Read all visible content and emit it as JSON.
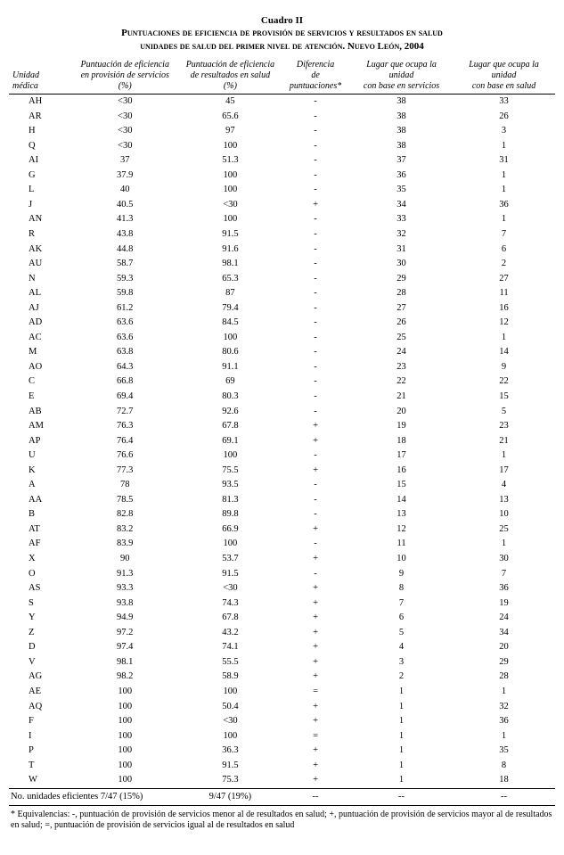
{
  "title": {
    "line1": "Cuadro II",
    "line2": "Puntuaciones de eficiencia de provisión de servicios y resultados en salud",
    "line3": "unidades de salud del primer nivel de atención. Nuevo León, 2004"
  },
  "headers": {
    "unidad": "Unidad médica",
    "h1a": "Puntuación de eficiencia",
    "h1b": "en provisión de servicios (%)",
    "h2a": "Puntuación de eficiencia",
    "h2b": "de resultados en salud (%)",
    "h3a": "Diferencia",
    "h3b": "de puntuaciones*",
    "h4a": "Lugar que ocupa la unidad",
    "h4b": "con base en servicios",
    "h5a": "Lugar que ocupa la unidad",
    "h5b": "con base en salud"
  },
  "chart_data": {
    "type": "table",
    "rows": [
      {
        "u": "AH",
        "c1": "<30",
        "c2": "45",
        "c3": "-",
        "c4": "38",
        "c5": "33"
      },
      {
        "u": "AR",
        "c1": "<30",
        "c2": "65.6",
        "c3": "-",
        "c4": "38",
        "c5": "26"
      },
      {
        "u": "H",
        "c1": "<30",
        "c2": "97",
        "c3": "-",
        "c4": "38",
        "c5": "3"
      },
      {
        "u": "Q",
        "c1": "<30",
        "c2": "100",
        "c3": "-",
        "c4": "38",
        "c5": "1"
      },
      {
        "u": "AI",
        "c1": "37",
        "c2": "51.3",
        "c3": "-",
        "c4": "37",
        "c5": "31"
      },
      {
        "u": "G",
        "c1": "37.9",
        "c2": "100",
        "c3": "-",
        "c4": "36",
        "c5": "1"
      },
      {
        "u": "L",
        "c1": "40",
        "c2": "100",
        "c3": "-",
        "c4": "35",
        "c5": "1"
      },
      {
        "u": "J",
        "c1": "40.5",
        "c2": "<30",
        "c3": "+",
        "c4": "34",
        "c5": "36"
      },
      {
        "u": "AN",
        "c1": "41.3",
        "c2": "100",
        "c3": "-",
        "c4": "33",
        "c5": "1"
      },
      {
        "u": "R",
        "c1": "43.8",
        "c2": "91.5",
        "c3": "-",
        "c4": "32",
        "c5": "7"
      },
      {
        "u": "AK",
        "c1": "44.8",
        "c2": "91.6",
        "c3": "-",
        "c4": "31",
        "c5": "6"
      },
      {
        "u": "AU",
        "c1": "58.7",
        "c2": "98.1",
        "c3": "-",
        "c4": "30",
        "c5": "2"
      },
      {
        "u": "N",
        "c1": "59.3",
        "c2": "65.3",
        "c3": "-",
        "c4": "29",
        "c5": "27"
      },
      {
        "u": "AL",
        "c1": "59.8",
        "c2": "87",
        "c3": "-",
        "c4": "28",
        "c5": "11"
      },
      {
        "u": "AJ",
        "c1": "61.2",
        "c2": "79.4",
        "c3": "-",
        "c4": "27",
        "c5": "16"
      },
      {
        "u": "AD",
        "c1": "63.6",
        "c2": "84.5",
        "c3": "-",
        "c4": "26",
        "c5": "12"
      },
      {
        "u": "AC",
        "c1": "63.6",
        "c2": "100",
        "c3": "-",
        "c4": "25",
        "c5": "1"
      },
      {
        "u": "M",
        "c1": "63.8",
        "c2": "80.6",
        "c3": "-",
        "c4": "24",
        "c5": "14"
      },
      {
        "u": "AO",
        "c1": "64.3",
        "c2": "91.1",
        "c3": "-",
        "c4": "23",
        "c5": "9"
      },
      {
        "u": "C",
        "c1": "66.8",
        "c2": "69",
        "c3": "-",
        "c4": "22",
        "c5": "22"
      },
      {
        "u": "E",
        "c1": "69.4",
        "c2": "80.3",
        "c3": "-",
        "c4": "21",
        "c5": "15"
      },
      {
        "u": "AB",
        "c1": "72.7",
        "c2": "92.6",
        "c3": "-",
        "c4": "20",
        "c5": "5"
      },
      {
        "u": "AM",
        "c1": "76.3",
        "c2": "67.8",
        "c3": "+",
        "c4": "19",
        "c5": "23"
      },
      {
        "u": "AP",
        "c1": "76.4",
        "c2": "69.1",
        "c3": "+",
        "c4": "18",
        "c5": "21"
      },
      {
        "u": "U",
        "c1": "76.6",
        "c2": "100",
        "c3": "-",
        "c4": "17",
        "c5": "1"
      },
      {
        "u": "K",
        "c1": "77.3",
        "c2": "75.5",
        "c3": "+",
        "c4": "16",
        "c5": "17"
      },
      {
        "u": "A",
        "c1": "78",
        "c2": "93.5",
        "c3": "-",
        "c4": "15",
        "c5": "4"
      },
      {
        "u": "AA",
        "c1": "78.5",
        "c2": "81.3",
        "c3": "-",
        "c4": "14",
        "c5": "13"
      },
      {
        "u": "B",
        "c1": "82.8",
        "c2": "89.8",
        "c3": "-",
        "c4": "13",
        "c5": "10"
      },
      {
        "u": "AT",
        "c1": "83.2",
        "c2": "66.9",
        "c3": "+",
        "c4": "12",
        "c5": "25"
      },
      {
        "u": "AF",
        "c1": "83.9",
        "c2": "100",
        "c3": "-",
        "c4": "11",
        "c5": "1"
      },
      {
        "u": "X",
        "c1": "90",
        "c2": "53.7",
        "c3": "+",
        "c4": "10",
        "c5": "30"
      },
      {
        "u": "O",
        "c1": "91.3",
        "c2": "91.5",
        "c3": "-",
        "c4": "9",
        "c5": "7"
      },
      {
        "u": "AS",
        "c1": "93.3",
        "c2": "<30",
        "c3": "+",
        "c4": "8",
        "c5": "36"
      },
      {
        "u": "S",
        "c1": "93.8",
        "c2": "74.3",
        "c3": "+",
        "c4": "7",
        "c5": "19"
      },
      {
        "u": "Y",
        "c1": "94.9",
        "c2": "67.8",
        "c3": "+",
        "c4": "6",
        "c5": "24"
      },
      {
        "u": "Z",
        "c1": "97.2",
        "c2": "43.2",
        "c3": "+",
        "c4": "5",
        "c5": "34"
      },
      {
        "u": "D",
        "c1": "97.4",
        "c2": "74.1",
        "c3": "+",
        "c4": "4",
        "c5": "20"
      },
      {
        "u": "V",
        "c1": "98.1",
        "c2": "55.5",
        "c3": "+",
        "c4": "3",
        "c5": "29"
      },
      {
        "u": "AG",
        "c1": "98.2",
        "c2": "58.9",
        "c3": "+",
        "c4": "2",
        "c5": "28"
      },
      {
        "u": "AE",
        "c1": "100",
        "c2": "100",
        "c3": "=",
        "c4": "1",
        "c5": "1"
      },
      {
        "u": "AQ",
        "c1": "100",
        "c2": "50.4",
        "c3": "+",
        "c4": "1",
        "c5": "32"
      },
      {
        "u": "F",
        "c1": "100",
        "c2": "<30",
        "c3": "+",
        "c4": "1",
        "c5": "36"
      },
      {
        "u": "I",
        "c1": "100",
        "c2": "100",
        "c3": "=",
        "c4": "1",
        "c5": "1"
      },
      {
        "u": "P",
        "c1": "100",
        "c2": "36.3",
        "c3": "+",
        "c4": "1",
        "c5": "35"
      },
      {
        "u": "T",
        "c1": "100",
        "c2": "91.5",
        "c3": "+",
        "c4": "1",
        "c5": "8"
      },
      {
        "u": "W",
        "c1": "100",
        "c2": "75.3",
        "c3": "+",
        "c4": "1",
        "c5": "18"
      }
    ],
    "summary": {
      "label": "No. unidades eficientes 7/47 (15%)",
      "c2": "9/47 (19%)",
      "c3": "--",
      "c4": "--",
      "c5": "--"
    }
  },
  "footnote": "* Equivalencias: -, puntuación de provisión de servicios menor al de resultados en salud; +, puntuación de provisión de servicios mayor al de resultados en salud; =, puntuación de provisión de servicios igual al de resultados en salud"
}
